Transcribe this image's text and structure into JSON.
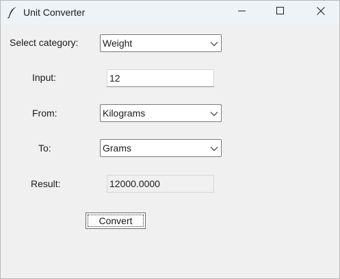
{
  "window": {
    "title": "Unit Converter",
    "icon": "feather-icon"
  },
  "form": {
    "category_label": "Select category:",
    "category_value": "Weight",
    "input_label": "Input:",
    "input_value": "12",
    "from_label": "From:",
    "from_value": "Kilograms",
    "to_label": "To:",
    "to_value": "Grams",
    "result_label": "Result:",
    "result_value": "12000.0000",
    "convert_label": "Convert"
  }
}
